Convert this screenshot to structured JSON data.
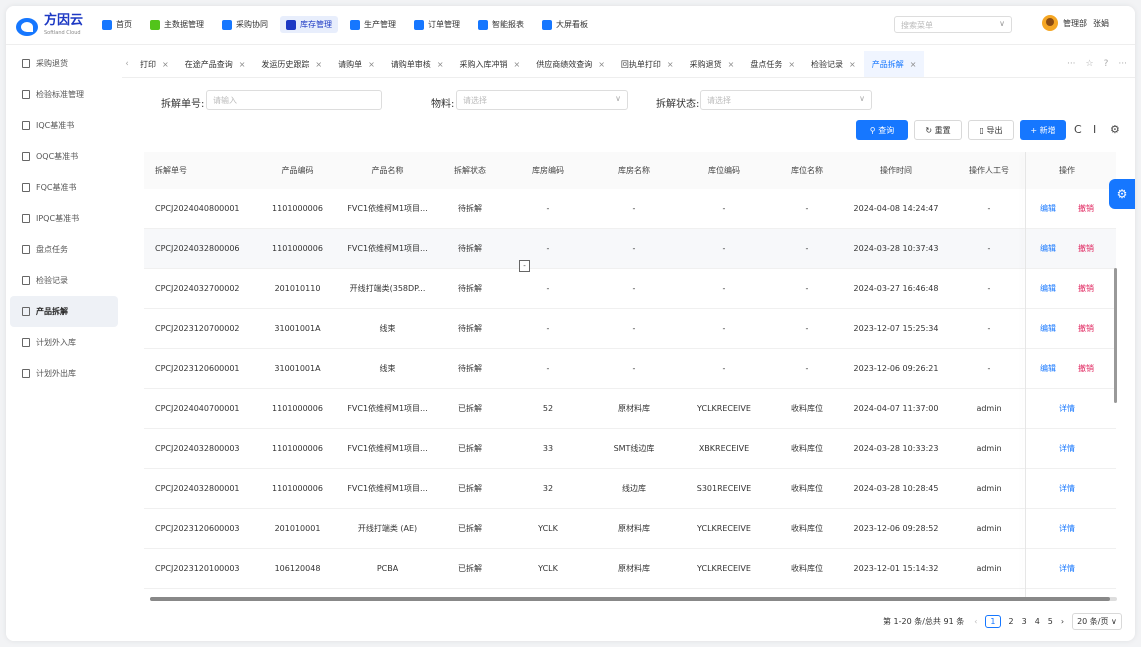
{
  "brand": {
    "name": "方因云",
    "sub": "Softland Cloud"
  },
  "nav": [
    {
      "label": "首页",
      "icon": "home-icon",
      "color": "#1677ff"
    },
    {
      "label": "主数据管理",
      "icon": "database-icon",
      "color": "#52c41a"
    },
    {
      "label": "采购协同",
      "icon": "cart-icon",
      "color": "#1677ff"
    },
    {
      "label": "库存管理",
      "icon": "warehouse-icon",
      "color": "#1d39c4",
      "active": true
    },
    {
      "label": "生产管理",
      "icon": "factory-icon",
      "color": "#1677ff"
    },
    {
      "label": "订单管理",
      "icon": "order-icon",
      "color": "#1677ff"
    },
    {
      "label": "智能报表",
      "icon": "report-icon",
      "color": "#1677ff"
    },
    {
      "label": "大屏看板",
      "icon": "dashboard-icon",
      "color": "#1677ff"
    }
  ],
  "menu_search": {
    "placeholder": "搜索菜单"
  },
  "user": {
    "dept": "管理部",
    "name": "张娟"
  },
  "sidebar": [
    {
      "label": "采购退货"
    },
    {
      "label": "检验标准管理"
    },
    {
      "label": "IQC基准书"
    },
    {
      "label": "OQC基准书"
    },
    {
      "label": "FQC基准书"
    },
    {
      "label": "IPQC基准书"
    },
    {
      "label": "盘点任务"
    },
    {
      "label": "检验记录"
    },
    {
      "label": "产品拆解",
      "active": true
    },
    {
      "label": "计划外入库"
    },
    {
      "label": "计划外出库"
    }
  ],
  "tabs": [
    {
      "label": "打印"
    },
    {
      "label": "在途产品查询"
    },
    {
      "label": "发运历史跟踪"
    },
    {
      "label": "请购单"
    },
    {
      "label": "请购单审核"
    },
    {
      "label": "采购入库冲销"
    },
    {
      "label": "供应商绩效查询"
    },
    {
      "label": "回执单打印"
    },
    {
      "label": "采购退货"
    },
    {
      "label": "盘点任务"
    },
    {
      "label": "检验记录"
    },
    {
      "label": "产品拆解",
      "active": true
    }
  ],
  "filters": {
    "order_no_label": "拆解单号:",
    "order_no_placeholder": "请输入",
    "material_label": "物料:",
    "material_placeholder": "请选择",
    "status_label": "拆解状态:",
    "status_placeholder": "请选择"
  },
  "actions": {
    "query": "查询",
    "reset": "重置",
    "export": "导出",
    "add": "新增"
  },
  "table": {
    "columns": [
      "拆解单号",
      "产品编码",
      "产品名称",
      "拆解状态",
      "库房编码",
      "库房名称",
      "库位编码",
      "库位名称",
      "操作时间",
      "操作人工号",
      "操作"
    ],
    "rows": [
      {
        "no": "CPCJ2024040800001",
        "code": "1101000006",
        "name": "FVC1依维柯M1项目...",
        "status": "待拆解",
        "wh_code": "-",
        "wh_name": "-",
        "loc_code": "-",
        "loc_name": "-",
        "time": "2024-04-08 14:24:47",
        "op_id": "-",
        "edit": "编辑",
        "undo": "撤销"
      },
      {
        "no": "CPCJ2024032800006",
        "code": "1101000006",
        "name": "FVC1依维柯M1项目...",
        "status": "待拆解",
        "wh_code": "-",
        "wh_name": "-",
        "loc_code": "-",
        "loc_name": "-",
        "time": "2024-03-28 10:37:43",
        "op_id": "-",
        "edit": "编辑",
        "undo": "撤销"
      },
      {
        "no": "CPCJ2024032700002",
        "code": "201010110",
        "name": "开线打端类(358DP...",
        "status": "待拆解",
        "wh_code": "-",
        "wh_name": "-",
        "loc_code": "-",
        "loc_name": "-",
        "time": "2024-03-27 16:46:48",
        "op_id": "-",
        "edit": "编辑",
        "undo": "撤销"
      },
      {
        "no": "CPCJ2023120700002",
        "code": "31001001A",
        "name": "线束",
        "status": "待拆解",
        "wh_code": "-",
        "wh_name": "-",
        "loc_code": "-",
        "loc_name": "-",
        "time": "2023-12-07 15:25:34",
        "op_id": "-",
        "edit": "编辑",
        "undo": "撤销"
      },
      {
        "no": "CPCJ2023120600001",
        "code": "31001001A",
        "name": "线束",
        "status": "待拆解",
        "wh_code": "-",
        "wh_name": "-",
        "loc_code": "-",
        "loc_name": "-",
        "time": "2023-12-06 09:26:21",
        "op_id": "-",
        "edit": "编辑",
        "undo": "撤销"
      },
      {
        "no": "CPCJ2024040700001",
        "code": "1101000006",
        "name": "FVC1依维柯M1项目...",
        "status": "已拆解",
        "wh_code": "52",
        "wh_name": "原材料库",
        "loc_code": "YCLKRECEIVE",
        "loc_name": "收料库位",
        "time": "2024-04-07 11:37:00",
        "op_id": "admin",
        "detail": "详情"
      },
      {
        "no": "CPCJ2024032800003",
        "code": "1101000006",
        "name": "FVC1依维柯M1项目...",
        "status": "已拆解",
        "wh_code": "33",
        "wh_name": "SMT线边库",
        "loc_code": "XBKRECEIVE",
        "loc_name": "收料库位",
        "time": "2024-03-28 10:33:23",
        "op_id": "admin",
        "detail": "详情"
      },
      {
        "no": "CPCJ2024032800001",
        "code": "1101000006",
        "name": "FVC1依维柯M1项目...",
        "status": "已拆解",
        "wh_code": "32",
        "wh_name": "线边库",
        "loc_code": "S301RECEIVE",
        "loc_name": "收料库位",
        "time": "2024-03-28 10:28:45",
        "op_id": "admin",
        "detail": "详情"
      },
      {
        "no": "CPCJ2023120600003",
        "code": "201010001",
        "name": "开线打端类 (AE)",
        "status": "已拆解",
        "wh_code": "YCLK",
        "wh_name": "原材料库",
        "loc_code": "YCLKRECEIVE",
        "loc_name": "收料库位",
        "time": "2023-12-06 09:28:52",
        "op_id": "admin",
        "detail": "详情"
      },
      {
        "no": "CPCJ2023120100003",
        "code": "106120048",
        "name": "PCBA",
        "status": "已拆解",
        "wh_code": "YCLK",
        "wh_name": "原材料库",
        "loc_code": "YCLKRECEIVE",
        "loc_name": "收料库位",
        "time": "2023-12-01 15:14:32",
        "op_id": "admin",
        "detail": "详情"
      }
    ]
  },
  "pagination": {
    "summary": "第 1-20 条/总共 91 条",
    "pages": [
      "1",
      "2",
      "3",
      "4",
      "5"
    ],
    "current": "1",
    "page_size": "20 条/页"
  },
  "colors": {
    "primary": "#1677ff",
    "danger": "#e0245e"
  }
}
